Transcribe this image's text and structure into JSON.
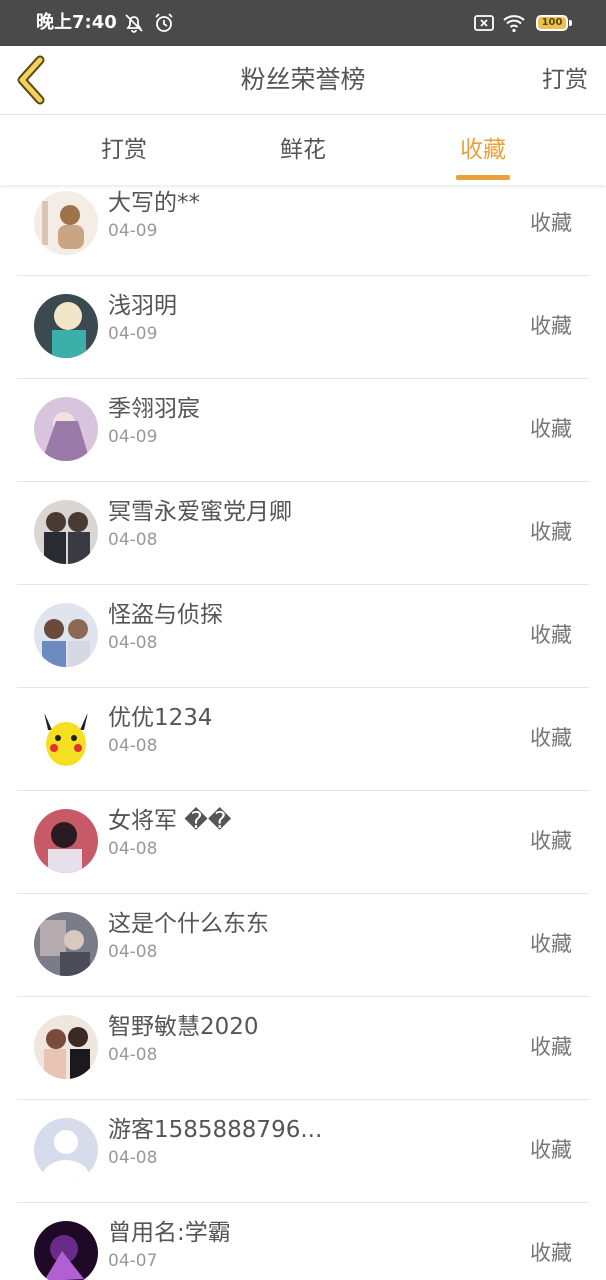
{
  "status_bar": {
    "time": "晚上7:40",
    "battery": "100"
  },
  "header": {
    "title": "粉丝荣誉榜",
    "action": "打赏"
  },
  "tabs": [
    {
      "label": "打赏"
    },
    {
      "label": "鲜花"
    },
    {
      "label": "收藏"
    }
  ],
  "active_tab": "收藏",
  "colors": {
    "accent": "#e9a23b",
    "status_bar": "#4a4a4a",
    "text": "#555555",
    "muted": "#999999"
  },
  "rows": [
    {
      "name": "大写的**",
      "date": "04-09",
      "type": "收藏"
    },
    {
      "name": "浅羽明",
      "date": "04-09",
      "type": "收藏"
    },
    {
      "name": "季翎羽宸",
      "date": "04-09",
      "type": "收藏"
    },
    {
      "name": "冥雪永爱蜜党月卿",
      "date": "04-08",
      "type": "收藏"
    },
    {
      "name": "怪盗与侦探",
      "date": "04-08",
      "type": "收藏"
    },
    {
      "name": "优优1234",
      "date": "04-08",
      "type": "收藏"
    },
    {
      "name": "女将军 ��",
      "date": "04-08",
      "type": "收藏"
    },
    {
      "name": "这是个什么东东",
      "date": "04-08",
      "type": "收藏"
    },
    {
      "name": "智野敏慧2020",
      "date": "04-08",
      "type": "收藏"
    },
    {
      "name": "游客1585888796...",
      "date": "04-08",
      "type": "收藏"
    },
    {
      "name": "曾用名:学霸",
      "date": "04-07",
      "type": "收藏"
    }
  ]
}
